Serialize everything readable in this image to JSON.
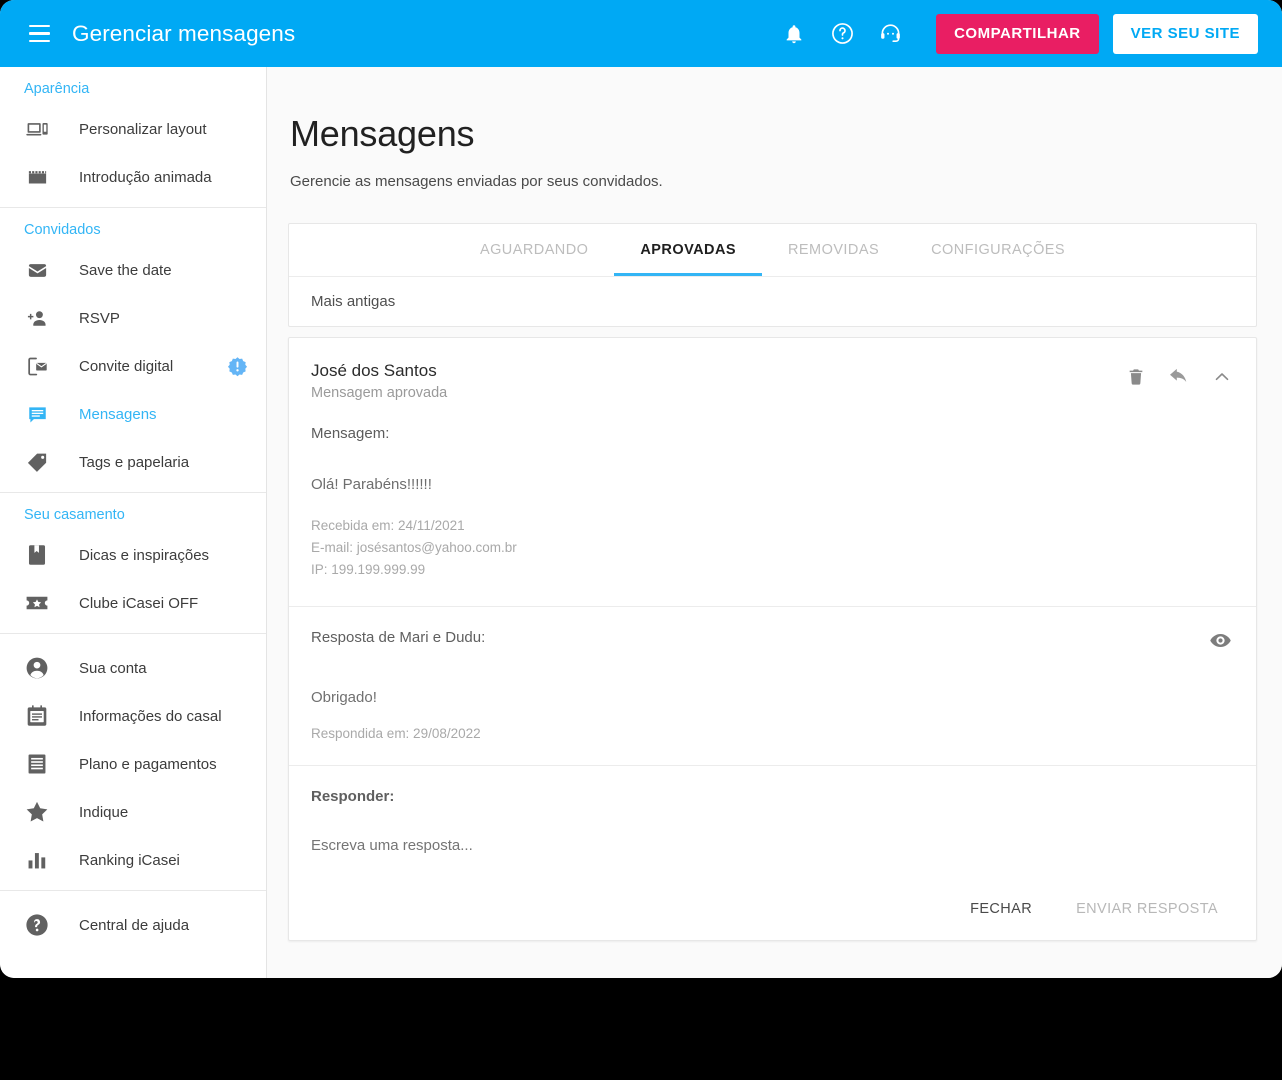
{
  "topbar": {
    "menu_icon": "hamburger-icon",
    "title": "Gerenciar mensagens",
    "icons": [
      {
        "name": "notifications-icon",
        "label": "Notificações"
      },
      {
        "name": "help-icon",
        "label": "Ajuda"
      },
      {
        "name": "support-headset-icon",
        "label": "Suporte"
      }
    ],
    "share_label": "COMPARTILHAR",
    "view_site_label": "VER SEU SITE",
    "bg_color": "#00A9F4",
    "share_color": "#E91E63",
    "view_site_text_color": "#00A9F4"
  },
  "sidebar": {
    "groups": [
      {
        "title": "Aparência",
        "items": [
          {
            "label": "Personalizar layout",
            "icon": "devices-icon",
            "active": false,
            "badge": false
          },
          {
            "label": "Introdução animada",
            "icon": "clapperboard-icon",
            "active": false,
            "badge": false
          }
        ]
      },
      {
        "title": "Convidados",
        "items": [
          {
            "label": "Save the date",
            "icon": "envelope-icon",
            "active": false,
            "badge": false
          },
          {
            "label": "RSVP",
            "icon": "person-add-icon",
            "active": false,
            "badge": false
          },
          {
            "label": "Convite digital",
            "icon": "mobile-invite-icon",
            "active": false,
            "badge": true
          },
          {
            "label": "Mensagens",
            "icon": "chat-bubble-icon",
            "active": true,
            "badge": false
          },
          {
            "label": "Tags e papelaria",
            "icon": "tag-icon",
            "active": false,
            "badge": false
          }
        ]
      },
      {
        "title": "Seu casamento",
        "items": [
          {
            "label": "Dicas e inspirações",
            "icon": "book-bookmark-icon",
            "active": false,
            "badge": false
          },
          {
            "label": "Clube iCasei OFF",
            "icon": "ticket-star-icon",
            "active": false,
            "badge": false
          }
        ]
      },
      {
        "title": "",
        "items": [
          {
            "label": "Sua conta",
            "icon": "account-circle-icon",
            "active": false,
            "badge": false
          },
          {
            "label": "Informações do casal",
            "icon": "contact-card-icon",
            "active": false,
            "badge": false
          },
          {
            "label": "Plano e pagamentos",
            "icon": "receipt-icon",
            "active": false,
            "badge": false
          },
          {
            "label": "Indique",
            "icon": "star-icon",
            "active": false,
            "badge": false
          },
          {
            "label": "Ranking iCasei",
            "icon": "bar-chart-icon",
            "active": false,
            "badge": false
          }
        ]
      },
      {
        "title": "",
        "items": [
          {
            "label": "Central de ajuda",
            "icon": "help-circle-icon",
            "active": false,
            "badge": false
          }
        ]
      }
    ],
    "group_title_color": "#33B5F5",
    "active_color": "#33B5F5"
  },
  "main": {
    "title": "Mensagens",
    "subtitle": "Gerencie as mensagens enviadas por seus convidados.",
    "tabs": [
      {
        "label": "AGUARDANDO",
        "active": false
      },
      {
        "label": "APROVADAS",
        "active": true
      },
      {
        "label": "REMOVIDAS",
        "active": false
      },
      {
        "label": "CONFIGURAÇÕES",
        "active": false
      }
    ],
    "sort_label": "Mais antigas",
    "message": {
      "author": "José dos Santos",
      "status": "Mensagem aprovada",
      "message_label": "Mensagem:",
      "body": "Olá! Parabéns!!!!!!",
      "received_at": "Recebida em: 24/11/2021",
      "email": "E-mail: josésantos@yahoo.com.br",
      "ip": "IP: 199.199.999.99",
      "actions": [
        {
          "name": "delete-icon",
          "label": "Excluir"
        },
        {
          "name": "reply-icon",
          "label": "Responder"
        },
        {
          "name": "chevron-up-icon",
          "label": "Recolher"
        }
      ]
    },
    "reply": {
      "label": "Resposta de Mari e Dudu:",
      "body": "Obrigado!",
      "date": "Respondida em: 29/08/2022",
      "visibility_icon": "eye-icon"
    },
    "responder": {
      "label": "Responder:",
      "placeholder": "Escreva uma resposta...",
      "value": ""
    },
    "footer": {
      "close_label": "FECHAR",
      "send_label": "ENVIAR RESPOSTA"
    }
  }
}
